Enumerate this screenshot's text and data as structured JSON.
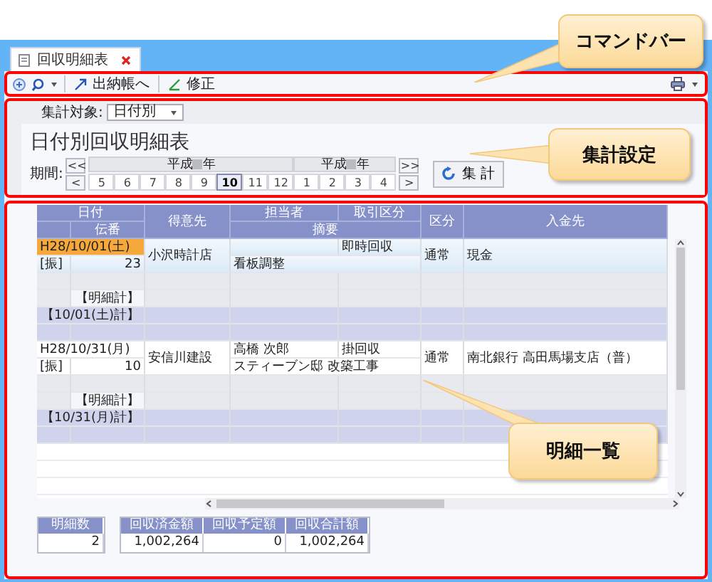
{
  "tab": {
    "title": "回収明細表"
  },
  "toolbar": {
    "buttons": [
      {
        "kind": "goto",
        "label": "出納帳へ"
      },
      {
        "kind": "edit",
        "label": "修正"
      }
    ]
  },
  "settings": {
    "target_label": "集計対象:",
    "target_value": "日付別",
    "title": "日付別回収明細表",
    "period_label": "期間:",
    "nav_prev": [
      "<<",
      "<"
    ],
    "nav_next": [
      ">>",
      ">"
    ],
    "years": [
      {
        "prefix": "平成",
        "suffix": "年",
        "months": [
          {
            "label": "5",
            "selected": false
          },
          {
            "label": "6",
            "selected": false
          },
          {
            "label": "7",
            "selected": false
          },
          {
            "label": "8",
            "selected": false
          },
          {
            "label": "9",
            "selected": false
          },
          {
            "label": "10",
            "selected": true
          },
          {
            "label": "11",
            "selected": false
          },
          {
            "label": "12",
            "selected": false
          }
        ]
      },
      {
        "prefix": "平成",
        "suffix": "年",
        "months": [
          {
            "label": "1",
            "selected": false
          },
          {
            "label": "2",
            "selected": false
          },
          {
            "label": "3",
            "selected": false
          },
          {
            "label": "4",
            "selected": false
          }
        ]
      }
    ],
    "run_button": "集 計"
  },
  "table": {
    "header_top": [
      "日付",
      "得意先",
      "担当者",
      "取引区分",
      "区分",
      "入金先"
    ],
    "header_bottom": [
      "伝番",
      "摘要"
    ],
    "groups": [
      {
        "date": "H28/10/01(土)",
        "selected": true,
        "customer": "小沢時計店",
        "trade_type": "即時回収",
        "category": "通常",
        "account": "現金",
        "slip_type": "[振]",
        "slip_no": "23",
        "memo": "看板調整",
        "detail_total": "【明細計】",
        "day_total": "【10/01(土)計】"
      },
      {
        "date": "H28/10/31(月)",
        "selected": false,
        "customer": "安信川建設",
        "staff": "高橋 次郎",
        "trade_type": "掛回収",
        "category": "通常",
        "account": "南北銀行 高田馬場支店（普）",
        "slip_type": "[振]",
        "slip_no": "10",
        "memo": "スティーブン邸 改築工事",
        "detail_total": "【明細計】",
        "day_total": "【10/31(月)計】"
      }
    ]
  },
  "footer": {
    "count": {
      "label": "明細数",
      "value": "2"
    },
    "totals": [
      {
        "label": "回収済金額",
        "value": "1,002,264"
      },
      {
        "label": "回収予定額",
        "value": "0"
      },
      {
        "label": "回収合計額",
        "value": "1,002,264"
      }
    ]
  },
  "callouts": [
    "コマンドバー",
    "集計設定",
    "明細一覧"
  ]
}
